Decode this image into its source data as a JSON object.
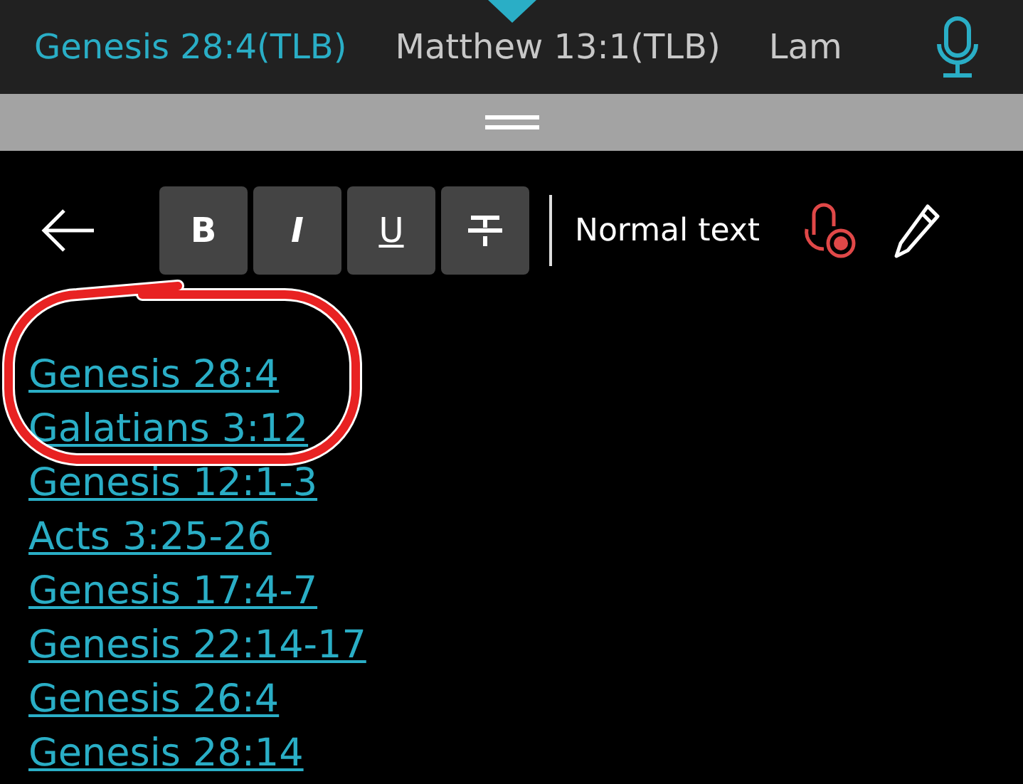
{
  "tabs": [
    {
      "label": "Genesis 28:4(TLB)",
      "selected": true
    },
    {
      "label": "Matthew 13:1(TLB)",
      "selected": false
    },
    {
      "label": "Lam",
      "selected": false
    }
  ],
  "toolbar": {
    "format_buttons": [
      {
        "kind": "bold",
        "label": "B"
      },
      {
        "kind": "italic",
        "label": "I"
      },
      {
        "kind": "underline",
        "label": "U"
      },
      {
        "kind": "strikethrough"
      }
    ],
    "style_label": "Normal text"
  },
  "links": [
    "Genesis 28:4",
    "Galatians 3:12",
    "Genesis 12:1-3",
    "Acts 3:25-26",
    "Genesis 17:4-7",
    "Genesis 22:14-17",
    "Genesis 26:4",
    "Genesis 28:14"
  ]
}
